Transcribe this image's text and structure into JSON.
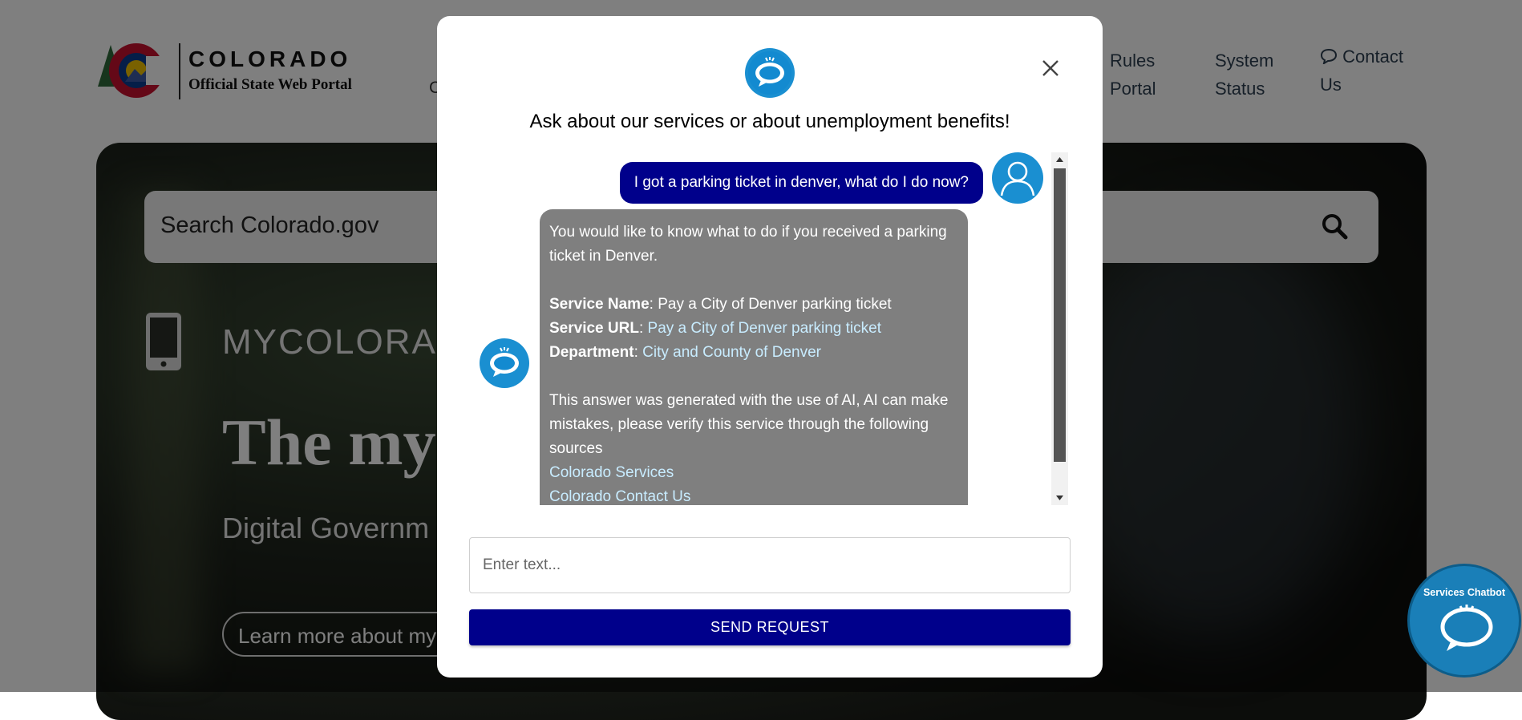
{
  "site": {
    "logo_title": "COLORADO",
    "logo_subtitle": "Official State Web Portal",
    "nav_partial": "C",
    "nav": [
      {
        "line1": "Rules",
        "line2": "Portal"
      },
      {
        "line1": "System",
        "line2": "Status"
      },
      {
        "line1": "Contact",
        "line2": "Us",
        "icon": "speech-bubble-icon"
      }
    ],
    "search_placeholder": "Search Colorado.gov",
    "hero": {
      "kicker": "MYCOLORAD",
      "title": "The my",
      "subtitle": "Digital Governm",
      "button": "Learn more about my"
    }
  },
  "launcher": {
    "label": "Services Chatbot",
    "icon": "chatbot-icon"
  },
  "chat": {
    "heading": "Ask about our services or about unemployment benefits!",
    "close_icon": "close-icon",
    "user_message": "I got a parking ticket in denver, what do I do now?",
    "bot": {
      "intro": "You would like to know what to do if you received a parking ticket in Denver.",
      "service_name_label": "Service Name",
      "service_name": "Pay a City of Denver parking ticket",
      "service_url_label": "Service URL",
      "service_url": "Pay a City of Denver parking ticket",
      "department_label": "Department",
      "department": "City and County of Denver",
      "disclaimer": "This answer was generated with the use of AI, AI can make mistakes, please verify this service through the following sources",
      "source_links": [
        "Colorado Services",
        "Colorado Contact Us"
      ]
    },
    "input_placeholder": "Enter text...",
    "send_label": "SEND REQUEST"
  },
  "colors": {
    "primary_navy": "#00008b",
    "bot_bubble": "#7f7f7f",
    "link": "#c8ecff",
    "chatbot_blue": "#1a8fd1"
  }
}
